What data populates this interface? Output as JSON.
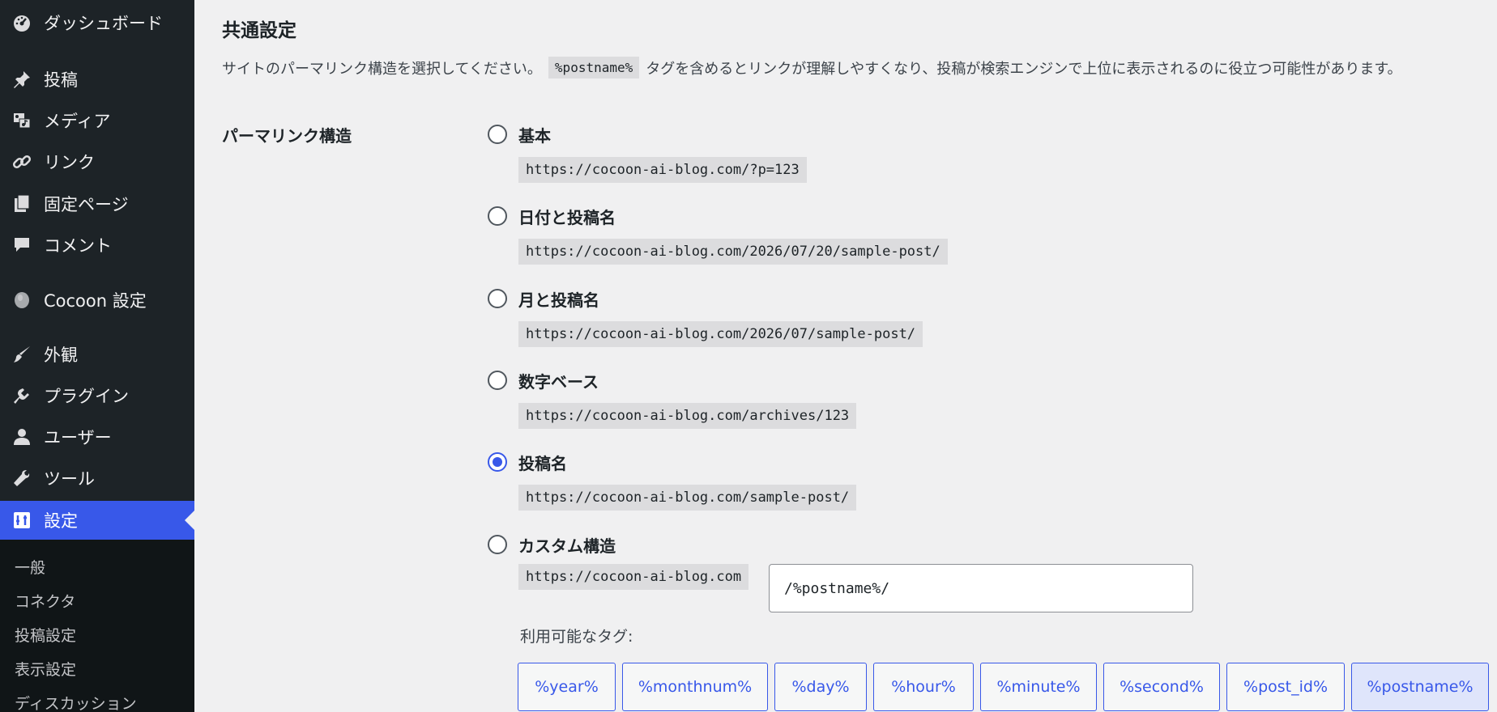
{
  "sidebar": {
    "items": [
      {
        "label": "ダッシュボード",
        "icon": "dashboard-icon"
      },
      {
        "label": "投稿",
        "icon": "pin-icon"
      },
      {
        "label": "メディア",
        "icon": "media-icon"
      },
      {
        "label": "リンク",
        "icon": "link-icon"
      },
      {
        "label": "固定ページ",
        "icon": "pages-icon"
      },
      {
        "label": "コメント",
        "icon": "comment-icon"
      },
      {
        "label": "Cocoon 設定",
        "icon": "cocoon-icon"
      },
      {
        "label": "外観",
        "icon": "brush-icon"
      },
      {
        "label": "プラグイン",
        "icon": "plugin-icon"
      },
      {
        "label": "ユーザー",
        "icon": "user-icon"
      },
      {
        "label": "ツール",
        "icon": "wrench-icon"
      },
      {
        "label": "設定",
        "icon": "settings-icon",
        "active": true
      }
    ],
    "submenu": [
      "一般",
      "コネクタ",
      "投稿設定",
      "表示設定",
      "ディスカッション"
    ]
  },
  "main": {
    "section_title": "共通設定",
    "description_before": "サイトのパーマリンク構造を選択してください。",
    "description_code": "%postname%",
    "description_after": "タグを含めるとリンクが理解しやすくなり、投稿が検索エンジンで上位に表示されるのに役立つ可能性があります。",
    "field_label": "パーマリンク構造",
    "options": [
      {
        "label": "基本",
        "url": "https://cocoon-ai-blog.com/?p=123",
        "checked": false
      },
      {
        "label": "日付と投稿名",
        "url": "https://cocoon-ai-blog.com/2026/07/20/sample-post/",
        "checked": false
      },
      {
        "label": "月と投稿名",
        "url": "https://cocoon-ai-blog.com/2026/07/sample-post/",
        "checked": false
      },
      {
        "label": "数字ベース",
        "url": "https://cocoon-ai-blog.com/archives/123",
        "checked": false
      },
      {
        "label": "投稿名",
        "url": "https://cocoon-ai-blog.com/sample-post/",
        "checked": true
      },
      {
        "label": "カスタム構造",
        "url": "",
        "checked": false
      }
    ],
    "custom_base": "https://cocoon-ai-blog.com",
    "custom_value": "/%postname%/",
    "tags_label": "利用可能なタグ:",
    "tags": [
      "%year%",
      "%monthnum%",
      "%day%",
      "%hour%",
      "%minute%",
      "%second%",
      "%post_id%",
      "%postname%"
    ],
    "selected_tag": "%postname%"
  },
  "colors": {
    "accent": "#3858e9",
    "sidebar_bg": "#1d2327",
    "page_bg": "#f0f0f1"
  }
}
